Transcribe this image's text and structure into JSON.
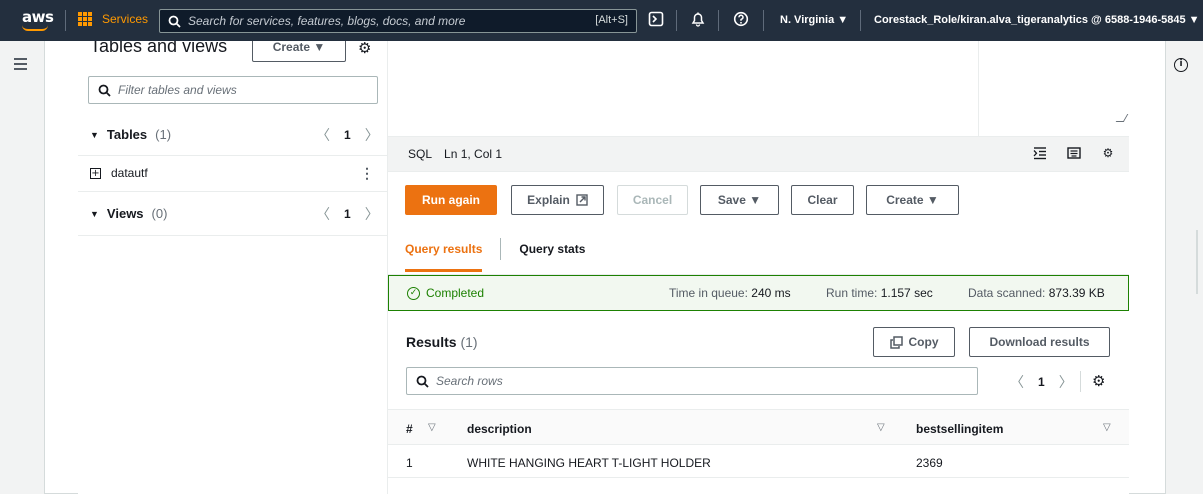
{
  "topnav": {
    "logo": "aws",
    "services_label": "Services",
    "search_placeholder": "Search for services, features, blogs, docs, and more",
    "search_shortcut": "[Alt+S]",
    "region": "N. Virginia ▼",
    "account": "Corestack_Role/kiran.alva_tigeranalytics @ 6588-1946-5845 ▼"
  },
  "left_panel": {
    "title": "Tables and views",
    "create_button": "Create ▼",
    "filter_placeholder": "Filter tables and views",
    "tables": {
      "label": "Tables",
      "count": "(1)",
      "page": "1",
      "items": [
        "datautf"
      ]
    },
    "views": {
      "label": "Views",
      "count": "(0)",
      "page": "1"
    }
  },
  "editor": {
    "language": "SQL",
    "cursor": "Ln 1, Col 1"
  },
  "toolbar": {
    "run_again": "Run again",
    "explain": "Explain",
    "cancel": "Cancel",
    "save": "Save ▼",
    "clear": "Clear",
    "create": "Create ▼"
  },
  "tabs": [
    "Query results",
    "Query stats"
  ],
  "status": {
    "state": "Completed",
    "queue_label": "Time in queue:",
    "queue_value": "240 ms",
    "runtime_label": "Run time:",
    "runtime_value": "1.157 sec",
    "scanned_label": "Data scanned:",
    "scanned_value": "873.39 KB"
  },
  "results": {
    "title": "Results",
    "count": "(1)",
    "copy_button": "Copy",
    "download_button": "Download results",
    "search_placeholder": "Search rows",
    "page": "1",
    "columns": [
      "#",
      "description",
      "bestsellingitem"
    ],
    "rows": [
      [
        "1",
        "WHITE HANGING HEART T-LIGHT HOLDER",
        "2369"
      ]
    ]
  },
  "colors": {
    "accent": "#ec7211",
    "nav_bg": "#232f3e",
    "success": "#1d8102"
  }
}
